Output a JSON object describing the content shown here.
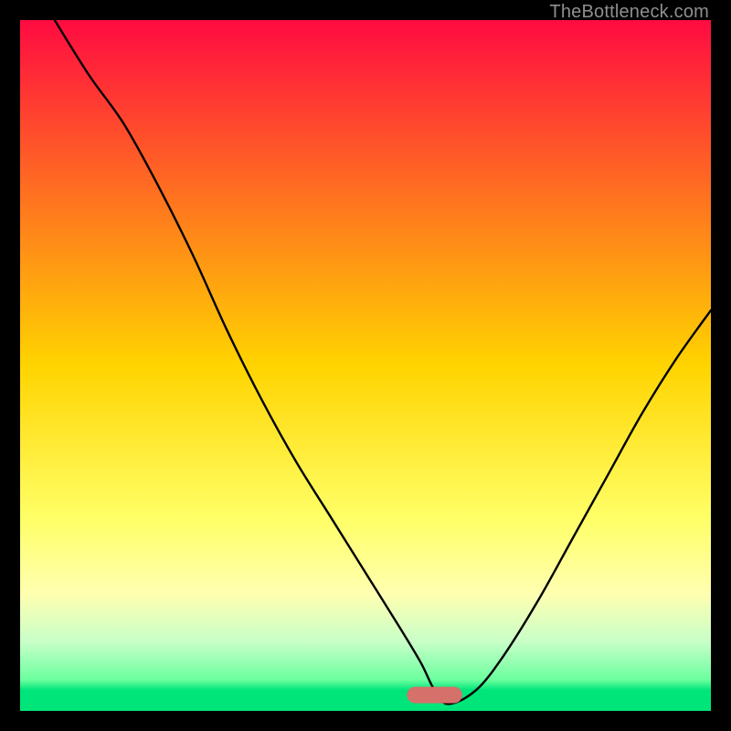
{
  "watermark": "TheBottleneck.com",
  "chart_data": {
    "type": "line",
    "title": "",
    "xlabel": "",
    "ylabel": "",
    "xlim": [
      0,
      100
    ],
    "ylim": [
      0,
      100
    ],
    "grid": false,
    "legend": false,
    "gradient_stops": [
      {
        "pos": 0.0,
        "color": "#ff0b41"
      },
      {
        "pos": 0.5,
        "color": "#ffd400"
      },
      {
        "pos": 0.72,
        "color": "#ffff66"
      },
      {
        "pos": 0.83,
        "color": "#ffffb0"
      },
      {
        "pos": 0.9,
        "color": "#c8ffc8"
      },
      {
        "pos": 0.955,
        "color": "#6bff9f"
      },
      {
        "pos": 0.97,
        "color": "#00e57a"
      },
      {
        "pos": 1.0,
        "color": "#00e57a"
      }
    ],
    "series": [
      {
        "name": "bottleneck-curve",
        "x": [
          5,
          10,
          15,
          20,
          25,
          30,
          35,
          40,
          45,
          50,
          55,
          58,
          60,
          62,
          66,
          70,
          75,
          80,
          85,
          90,
          95,
          100
        ],
        "values": [
          100,
          92,
          85,
          76,
          66,
          55,
          45,
          36,
          28,
          20,
          12,
          7,
          3,
          1,
          3,
          8,
          16,
          25,
          34,
          43,
          51,
          58
        ]
      }
    ],
    "marker": {
      "shape": "capsule",
      "x_center": 60,
      "y": 2.3,
      "width_x_units": 8,
      "color": "#d6706b"
    }
  }
}
